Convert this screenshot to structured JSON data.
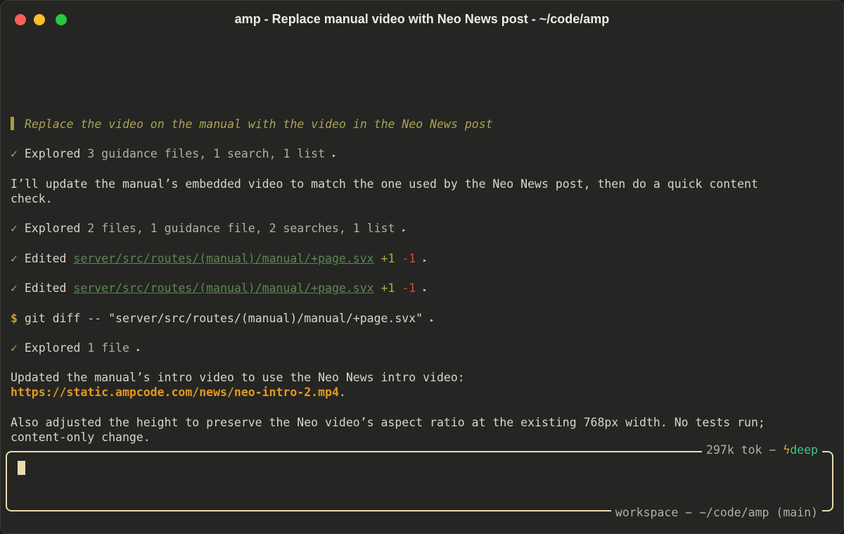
{
  "window": {
    "title": "amp - Replace manual video with Neo News post - ~/code/amp"
  },
  "thread": {
    "user_message": "Replace the video on the manual with the video in the Neo News post",
    "explored1": {
      "verb": "Explored",
      "detail": "3 guidance files, 1 search, 1 list"
    },
    "reply1_line1": "I’ll update the manual’s embedded video to match the one used by the Neo News post, then do a quick content",
    "reply1_line2": "check.",
    "explored2": {
      "verb": "Explored",
      "detail": "2 files, 1 guidance file, 2 searches, 1 list"
    },
    "edit1": {
      "verb": "Edited",
      "file": "server/src/routes/(manual)/manual/+page.svx",
      "added": "+1",
      "removed": "-1"
    },
    "edit2": {
      "verb": "Edited",
      "file": "server/src/routes/(manual)/manual/+page.svx",
      "added": "+1",
      "removed": "-1"
    },
    "command": {
      "prompt": "$",
      "text": "git diff -- \"server/src/routes/(manual)/manual/+page.svx\""
    },
    "explored3": {
      "verb": "Explored",
      "detail": "1 file"
    },
    "summary_line1": "Updated the manual’s intro video to use the Neo News intro video:",
    "summary_url": "https://static.ampcode.com/news/neo-intro-2.mp4",
    "summary_url_suffix": ".",
    "note_line1": "Also adjusted the height to preserve the Neo video’s aspect ratio at the existing 768px width. No tests run;",
    "note_line2": "content-only change."
  },
  "glyphs": {
    "check": "✓",
    "expand": "▸",
    "bolt": "ϟ",
    "dash": "−"
  },
  "input": {
    "tokens": "297k tok",
    "mode": "deep",
    "workspace_label": "workspace",
    "path": "~/code/amp (main)"
  },
  "colors": {
    "accent_green": "#3fc88a",
    "quote": "#a8a455",
    "url": "#e09a20",
    "border": "#e8dcb0"
  }
}
